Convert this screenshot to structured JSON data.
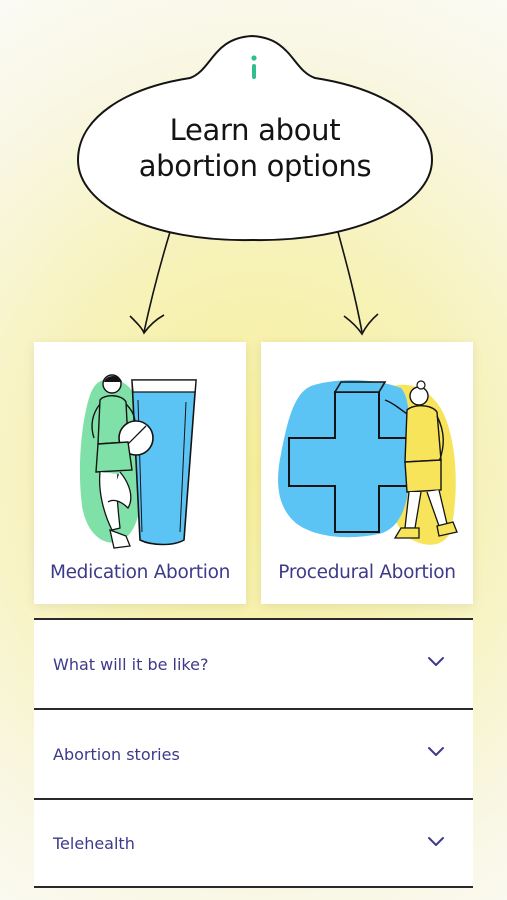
{
  "header": {
    "info_icon": "info-icon",
    "bubble_line1": "Learn about",
    "bubble_line2": "abortion options"
  },
  "cards": [
    {
      "label": "Medication Abortion",
      "illustration": "person-leaning-on-glass",
      "accent": "#5ad6a2"
    },
    {
      "label": "Procedural Abortion",
      "illustration": "person-with-medical-cross",
      "accent": "#56b9f2"
    }
  ],
  "accordion": [
    {
      "label": "What will it be like?",
      "icon": "chevron-down-icon"
    },
    {
      "label": "Abortion stories",
      "icon": "chevron-down-icon"
    },
    {
      "label": "Telehealth",
      "icon": "chevron-down-icon"
    }
  ],
  "colors": {
    "text_accent": "#3d3a8a",
    "info_green": "#2fbf8f",
    "yellow_glow": "#f6ef9a",
    "blue": "#5bc4f5",
    "green": "#7fe0a8",
    "yellow": "#f7e45a"
  }
}
